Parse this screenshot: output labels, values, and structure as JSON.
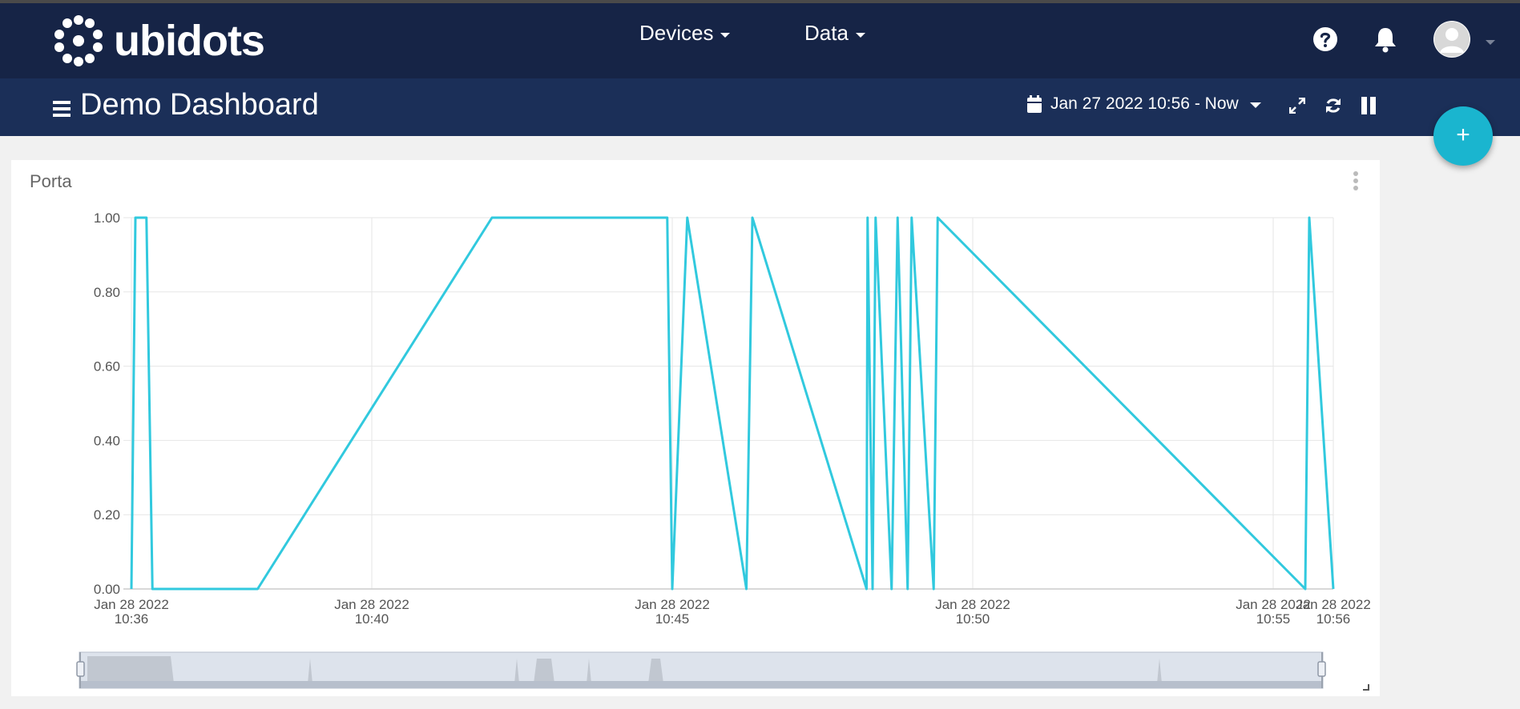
{
  "brand": {
    "name": "ubidots",
    "icon": "ubidots-logo-dots"
  },
  "nav": {
    "devices": "Devices",
    "data": "Data"
  },
  "header_icons": {
    "help": "question-circle-icon",
    "notifications": "bell-icon",
    "user": "avatar-icon"
  },
  "dashboard": {
    "title": "Demo Dashboard",
    "date_range": "Jan 27 2022 10:56 - Now",
    "toolbar_icons": [
      "expand-icon",
      "refresh-icon",
      "pause-icon"
    ],
    "add_button": "+"
  },
  "colors": {
    "topbar": "#162446",
    "subbar": "#1b2f58",
    "accent": "#1ab5cf",
    "series": "#31c9de"
  },
  "widget": {
    "title": "Porta"
  },
  "chart_data": {
    "type": "line",
    "title": "Porta",
    "xlabel": "",
    "ylabel": "",
    "ylim": [
      0,
      1
    ],
    "yticks": [
      "0.00",
      "0.20",
      "0.40",
      "0.60",
      "0.80",
      "1.00"
    ],
    "xlim": [
      "Jan 28 2022 10:36",
      "Jan 28 2022 10:56"
    ],
    "xticks": [
      {
        "date": "Jan 28 2022",
        "time": "10:36"
      },
      {
        "date": "Jan 28 2022",
        "time": "10:40"
      },
      {
        "date": "Jan 28 2022",
        "time": "10:45"
      },
      {
        "date": "Jan 28 2022",
        "time": "10:50"
      },
      {
        "date": "Jan 28 2022",
        "time": "10:55"
      },
      {
        "date": "Jan 28 2022",
        "time": "10:56"
      }
    ],
    "grid": true,
    "series": [
      {
        "x": [
          "10:36:00",
          "10:36:04",
          "10:36:15",
          "10:36:21",
          "10:38:06",
          "10:42:00",
          "10:44:55",
          "10:45:00",
          "10:45:15",
          "10:46:14",
          "10:46:20",
          "10:48:14",
          "10:48:15",
          "10:48:20",
          "10:48:23",
          "10:48:39",
          "10:48:45",
          "10:48:55",
          "10:48:59",
          "10:49:21",
          "10:49:25",
          "10:55:32",
          "10:55:36",
          "10:56:00"
        ],
        "y": [
          0,
          1,
          1,
          0,
          0,
          1,
          1,
          0,
          1,
          0,
          1,
          0,
          1,
          0,
          1,
          0,
          1,
          0,
          1,
          0,
          1,
          0,
          1,
          0
        ]
      }
    ]
  }
}
